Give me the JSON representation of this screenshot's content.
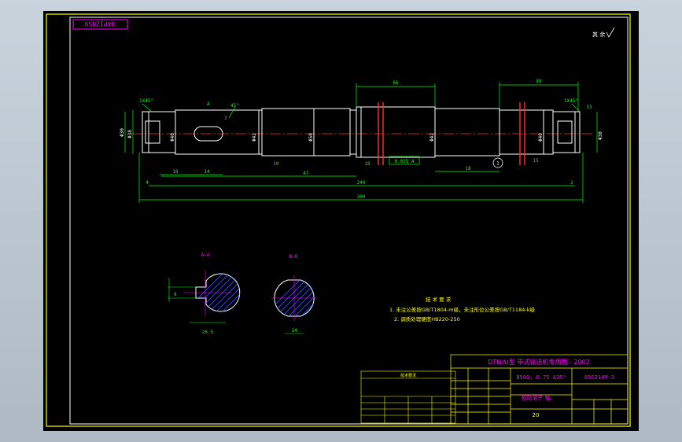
{
  "colors": {
    "background": "#000000",
    "frame": "#ffff00",
    "geometry": "#ffffff",
    "dimension": "#00ff00",
    "annotation": "#ff00ff",
    "centerline": "#ff3030",
    "hatch": "#3a5cff",
    "text_yellow": "#ffff00"
  },
  "corner_tag": "04PIZ059",
  "roughness_note": "其 余",
  "shaft": {
    "chamfer_left": "1X45°",
    "chamfer_right": "1X45°",
    "section_a": "A",
    "callout_3": "3",
    "note_angle": "45°",
    "dims_top": [
      "66",
      "80"
    ],
    "dim_overall": "300",
    "dim_main": "244",
    "dim_mid": "47",
    "dim_left_small": "4",
    "dim_right_small": "2",
    "dim_seg_a": "18",
    "dim_seg_b": "14",
    "dim_seg_c": "18",
    "dim_right_seg": "33",
    "dim_step_1": "10",
    "dim_step_2": "18",
    "dim_step_3": "15",
    "tol_box": "0.025 A",
    "circle_label": "1",
    "dia_labels": [
      "Φ30",
      "Φ38",
      "Φ40",
      "Φ42",
      "Φ50",
      "Φ42",
      "Φ40",
      "Φ30"
    ]
  },
  "sections": {
    "aa_label": "A-A",
    "bb_label": "B-B",
    "aa_dims": [
      "26.5",
      "8"
    ],
    "bb_dims": [
      "14"
    ]
  },
  "tech_req": {
    "title": "技 术 要 求",
    "line1": "1. 未注公差按GB/T1804-m级，未注形位公差按GB/T1184-k级",
    "line2": "2. 调质处理硬度HB220-250"
  },
  "title_block": {
    "project": "DTⅡ(A)型  带式输送机专用图 - 2002",
    "spec": "B500, 0.75 A35°",
    "drawing_no": "65C214M-3",
    "part_name": "驱动滚子 轴",
    "scale": "20"
  },
  "table": {
    "title": "技术要求"
  }
}
